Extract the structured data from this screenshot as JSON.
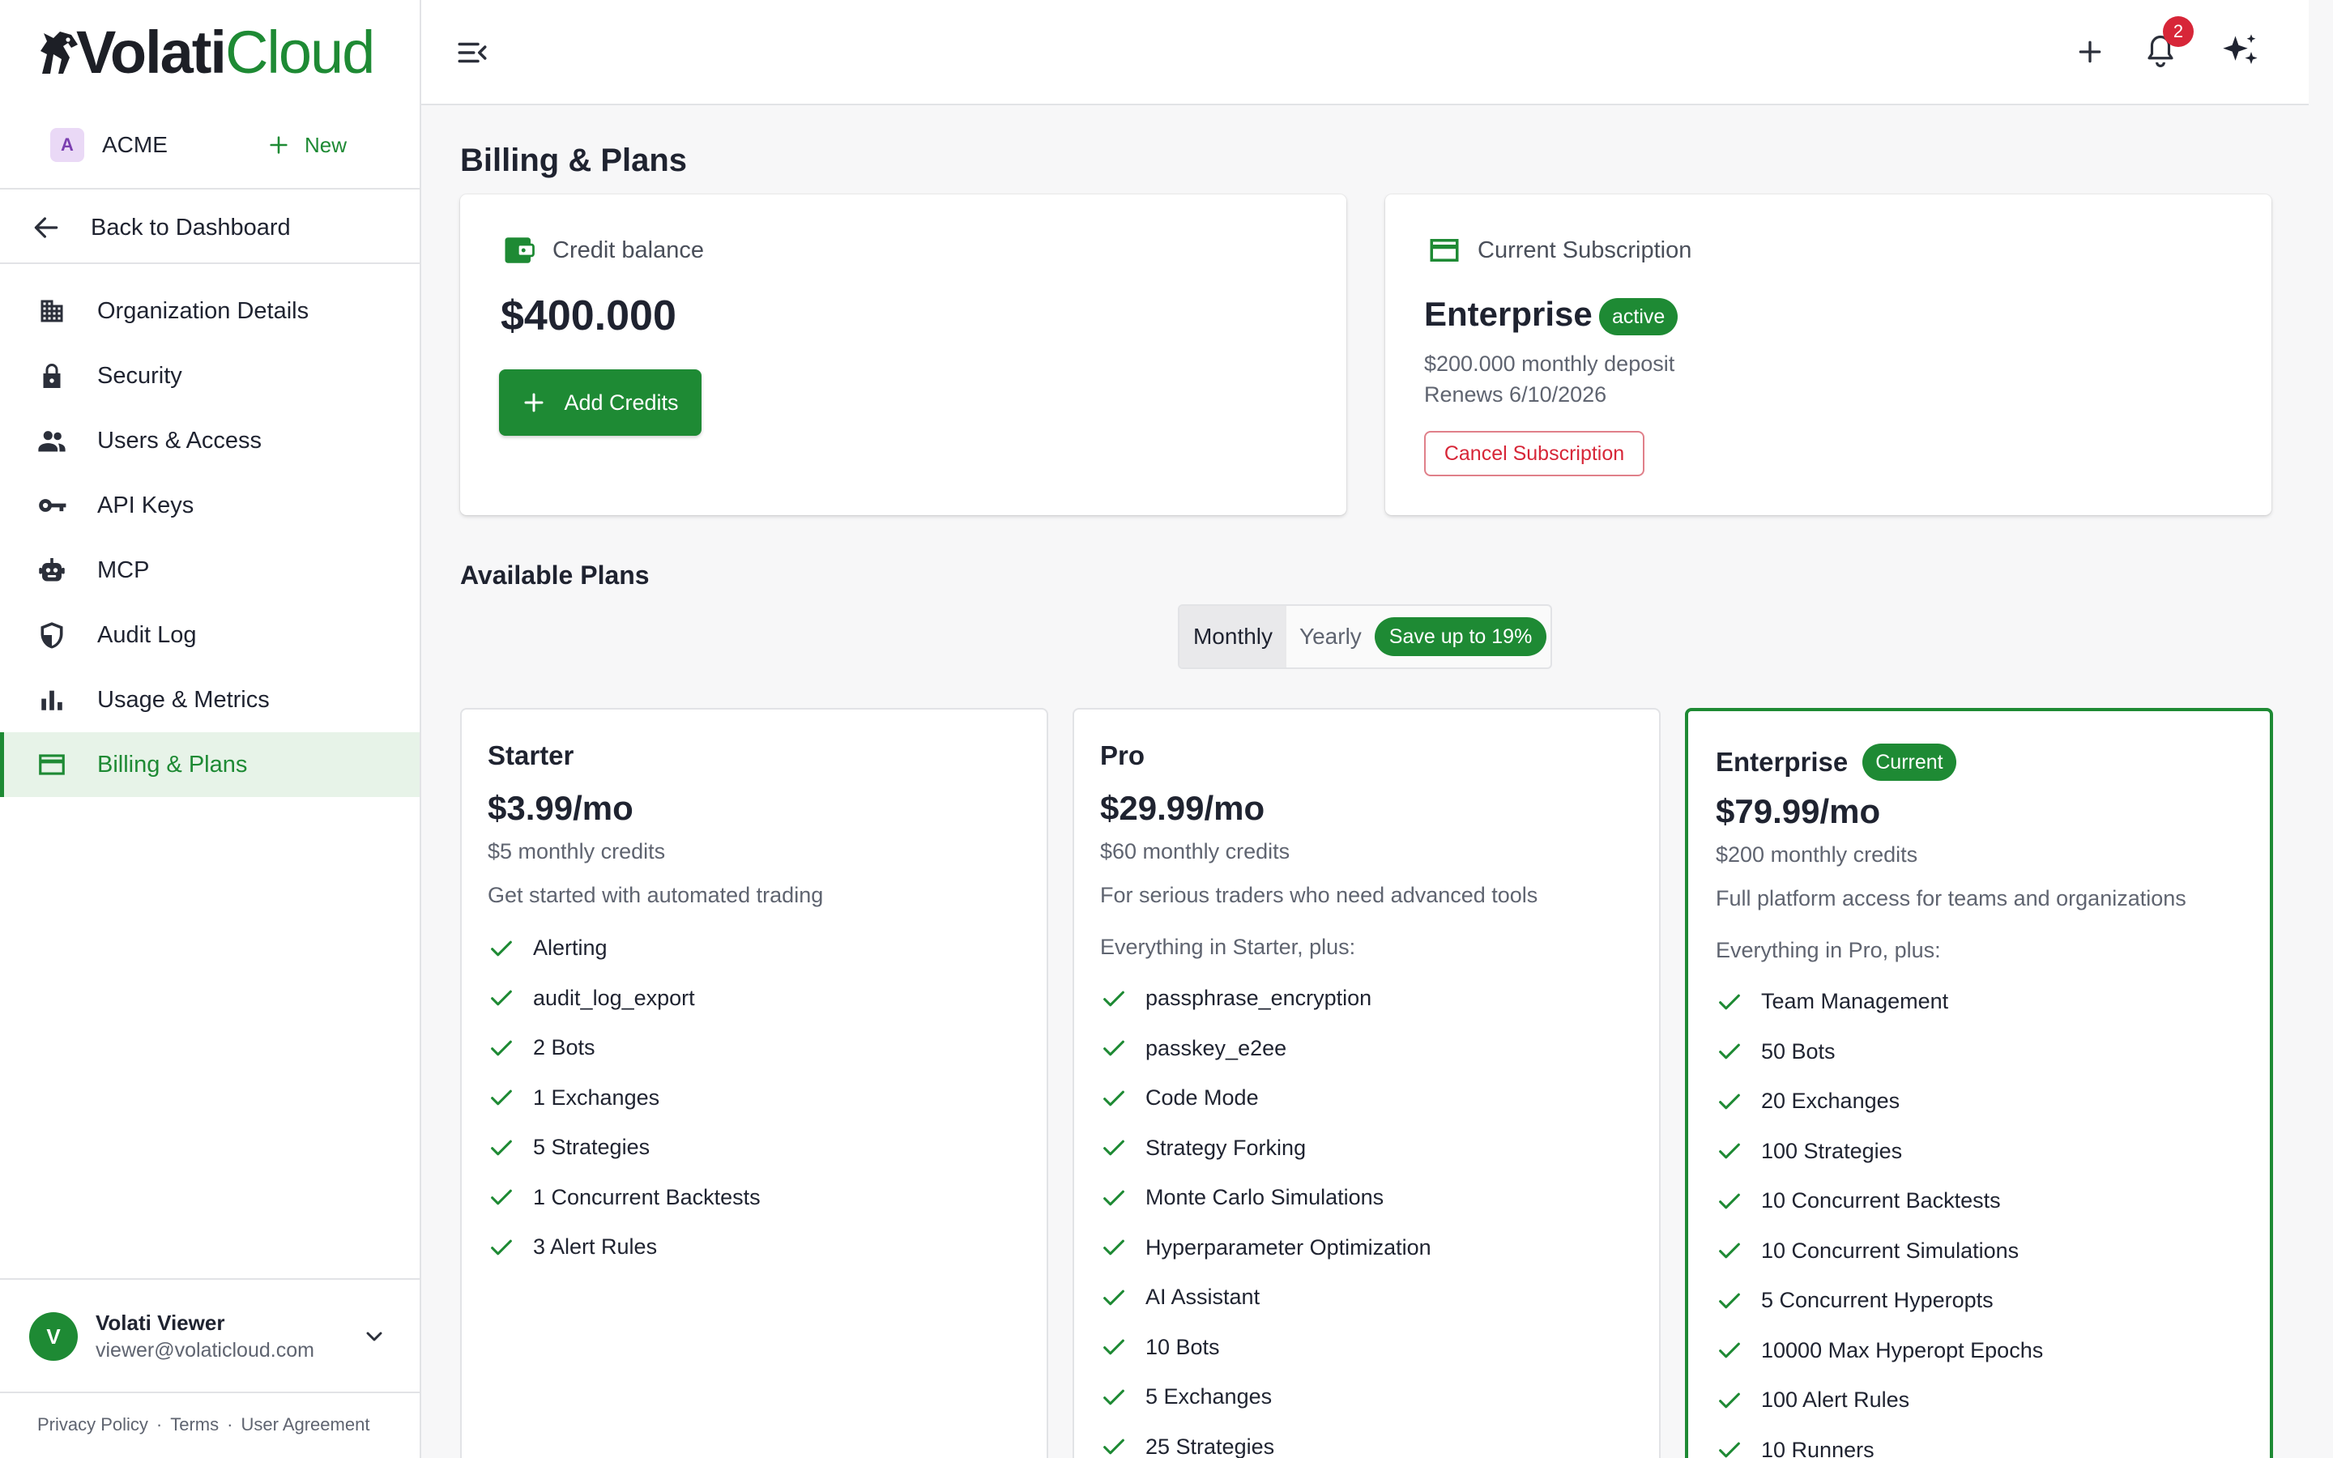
{
  "brand": {
    "name_part1": "Volati",
    "name_part2": "Cloud",
    "accent": "#1e8a34"
  },
  "org": {
    "initial": "A",
    "name": "ACME",
    "new_label": "New"
  },
  "sidebar": {
    "back_label": "Back to Dashboard",
    "items": [
      {
        "label": "Organization Details",
        "icon": "building-icon"
      },
      {
        "label": "Security",
        "icon": "lock-icon"
      },
      {
        "label": "Users & Access",
        "icon": "people-icon"
      },
      {
        "label": "API Keys",
        "icon": "key-icon"
      },
      {
        "label": "MCP",
        "icon": "robot-icon"
      },
      {
        "label": "Audit Log",
        "icon": "shield-icon"
      },
      {
        "label": "Usage & Metrics",
        "icon": "bar-chart-icon"
      },
      {
        "label": "Billing & Plans",
        "icon": "credit-card-icon",
        "active": true
      }
    ]
  },
  "user": {
    "initial": "V",
    "name": "Volati Viewer",
    "email": "viewer@volaticloud.com"
  },
  "footer": {
    "privacy": "Privacy Policy",
    "terms": "Terms",
    "agreement": "User Agreement",
    "sep": "·"
  },
  "topbar": {
    "notification_count": "2"
  },
  "page": {
    "title": "Billing & Plans"
  },
  "credit": {
    "label": "Credit balance",
    "amount": "$400.000",
    "add_label": "Add Credits"
  },
  "subscription": {
    "label": "Current Subscription",
    "plan": "Enterprise",
    "status": "active",
    "deposit": "$200.000 monthly deposit",
    "renews": "Renews 6/10/2026",
    "cancel_label": "Cancel Subscription"
  },
  "plans_section": {
    "title": "Available Plans",
    "toggle_monthly": "Monthly",
    "toggle_yearly": "Yearly",
    "save_badge": "Save up to 19%",
    "selected": "Monthly"
  },
  "plans": [
    {
      "name": "Starter",
      "price": "$3.99/mo",
      "credits": "$5 monthly credits",
      "description": "Get started with automated trading",
      "intro": "",
      "features": [
        "Alerting",
        "audit_log_export",
        "2 Bots",
        "1 Exchanges",
        "5 Strategies",
        "1 Concurrent Backtests",
        "3 Alert Rules"
      ]
    },
    {
      "name": "Pro",
      "price": "$29.99/mo",
      "credits": "$60 monthly credits",
      "description": "For serious traders who need advanced tools",
      "intro": "Everything in Starter, plus:",
      "features": [
        "passphrase_encryption",
        "passkey_e2ee",
        "Code Mode",
        "Strategy Forking",
        "Monte Carlo Simulations",
        "Hyperparameter Optimization",
        "AI Assistant",
        "10 Bots",
        "5 Exchanges",
        "25 Strategies"
      ]
    },
    {
      "name": "Enterprise",
      "badge": "Current",
      "price": "$79.99/mo",
      "credits": "$200 monthly credits",
      "description": "Full platform access for teams and organizations",
      "intro": "Everything in Pro, plus:",
      "features": [
        "Team Management",
        "50 Bots",
        "20 Exchanges",
        "100 Strategies",
        "10 Concurrent Backtests",
        "10 Concurrent Simulations",
        "5 Concurrent Hyperopts",
        "10000 Max Hyperopt Epochs",
        "100 Alert Rules",
        "10 Runners"
      ]
    }
  ]
}
